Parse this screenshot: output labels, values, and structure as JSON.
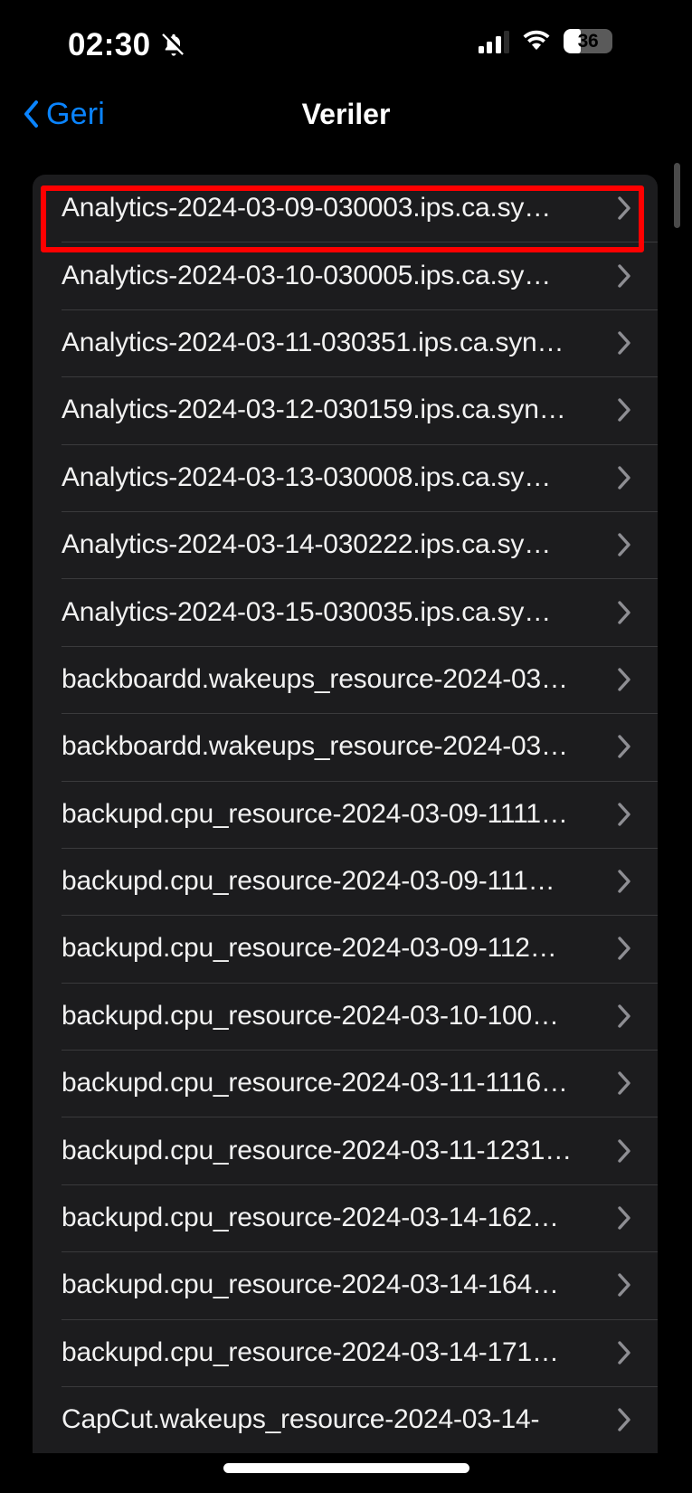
{
  "status_bar": {
    "time": "02:30",
    "mute_icon": "bell-slash-icon",
    "signal_icon": "cellular-signal-icon",
    "wifi_icon": "wifi-icon",
    "battery_percent": "36",
    "battery_level": 36
  },
  "nav": {
    "back_label": "Geri",
    "back_icon": "chevron-left-icon",
    "title": "Veriler"
  },
  "list": {
    "disclosure_icon": "chevron-right-icon",
    "items": [
      {
        "label": "Analytics-2024-03-09-030003.ips.ca.sy…",
        "highlighted": true
      },
      {
        "label": "Analytics-2024-03-10-030005.ips.ca.sy…",
        "highlighted": false
      },
      {
        "label": "Analytics-2024-03-11-030351.ips.ca.syn…",
        "highlighted": false
      },
      {
        "label": "Analytics-2024-03-12-030159.ips.ca.syn…",
        "highlighted": false
      },
      {
        "label": "Analytics-2024-03-13-030008.ips.ca.sy…",
        "highlighted": false
      },
      {
        "label": "Analytics-2024-03-14-030222.ips.ca.sy…",
        "highlighted": false
      },
      {
        "label": "Analytics-2024-03-15-030035.ips.ca.sy…",
        "highlighted": false
      },
      {
        "label": "backboardd.wakeups_resource-2024-03…",
        "highlighted": false
      },
      {
        "label": "backboardd.wakeups_resource-2024-03…",
        "highlighted": false
      },
      {
        "label": "backupd.cpu_resource-2024-03-09-1111…",
        "highlighted": false
      },
      {
        "label": "backupd.cpu_resource-2024-03-09-111…",
        "highlighted": false
      },
      {
        "label": "backupd.cpu_resource-2024-03-09-112…",
        "highlighted": false
      },
      {
        "label": "backupd.cpu_resource-2024-03-10-100…",
        "highlighted": false
      },
      {
        "label": "backupd.cpu_resource-2024-03-11-1116…",
        "highlighted": false
      },
      {
        "label": "backupd.cpu_resource-2024-03-11-1231…",
        "highlighted": false
      },
      {
        "label": "backupd.cpu_resource-2024-03-14-162…",
        "highlighted": false
      },
      {
        "label": "backupd.cpu_resource-2024-03-14-164…",
        "highlighted": false
      },
      {
        "label": "backupd.cpu_resource-2024-03-14-171…",
        "highlighted": false
      },
      {
        "label": "CapCut.wakeups_resource-2024-03-14-",
        "highlighted": false
      }
    ]
  },
  "colors": {
    "accent": "#0a84ff",
    "highlight": "#ff0000",
    "row_bg": "#1c1c1e",
    "page_bg": "#000000",
    "separator": "#3a3a3c",
    "text": "#f2f2f2"
  }
}
